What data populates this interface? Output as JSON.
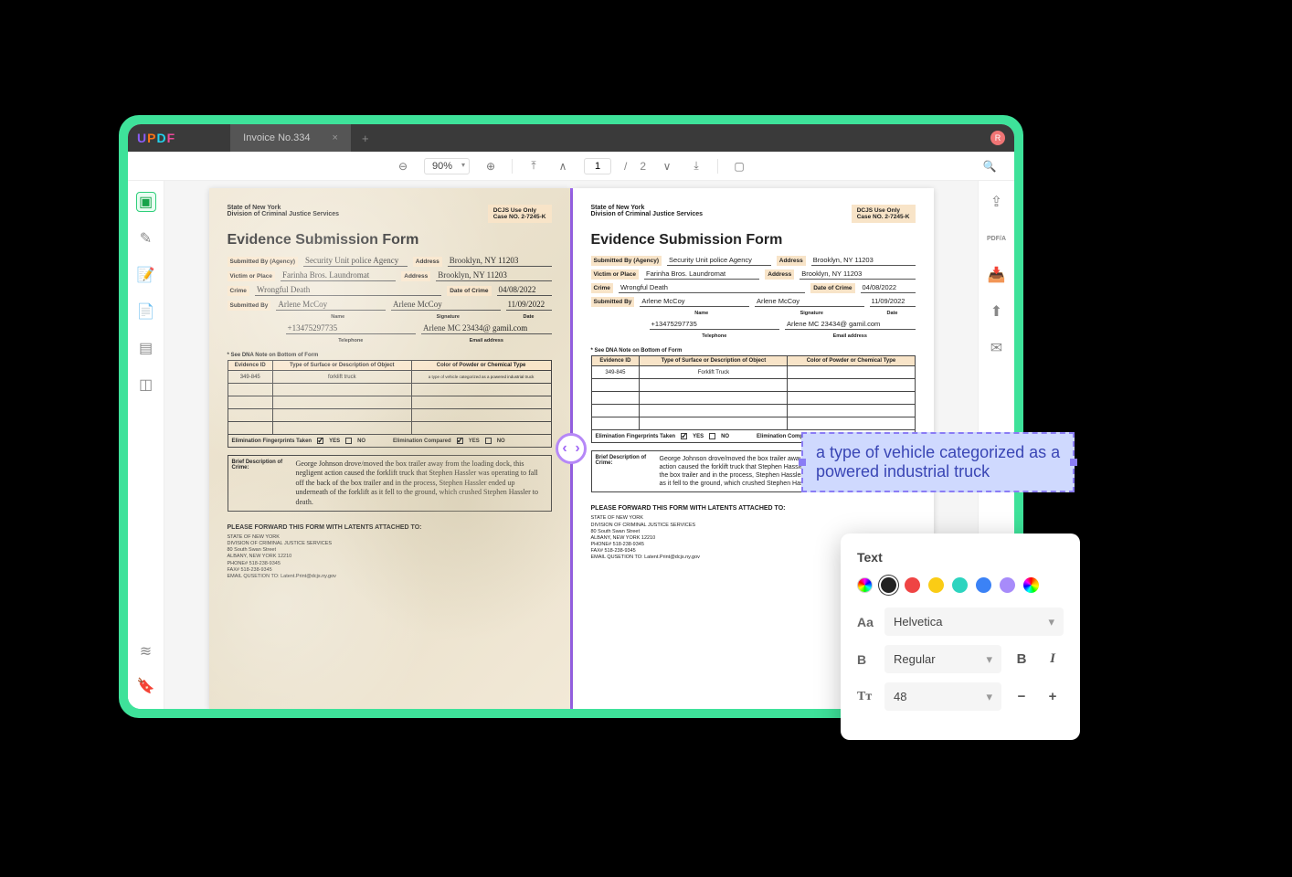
{
  "titlebar": {
    "tab": "Invoice No.334",
    "avatar": "R"
  },
  "toolbar": {
    "zoom": "90%",
    "pageCurrent": "1",
    "pageSep": "/",
    "pageTotal": "2"
  },
  "form": {
    "hdr1": "State of New York",
    "hdr2": "Division of Criminal Justice Services",
    "box1": "DCJS Use Only",
    "box2": "Case NO. 2-7245-K",
    "title": "Evidence Submission Form",
    "labels": {
      "subBy": "Submitted By (Agency)",
      "addr": "Address",
      "victim": "Victim or Place",
      "crime": "Crime",
      "dateCrime": "Date of Crime",
      "subBy2": "Submitted By",
      "name": "Name",
      "sig": "Signature",
      "date": "Date",
      "tel": "Telephone",
      "email": "Email address"
    },
    "scan": {
      "subBy": "Security Unit police Agency",
      "addr1": "Brooklyn, NY 11203",
      "victim": "Farinha Bros. Laundromat",
      "addr2": "Brooklyn, NY 11203",
      "crime": "Wrongful Death",
      "dateCrime": "04/08/2022",
      "name": "Arlene McCoy",
      "sig": "Arlene McCoy",
      "date": "11/09/2022",
      "tel": "+13475297735",
      "email": "Arlene MC 23434@ gamil.com"
    },
    "clean": {
      "subBy": "Security Unit police Agency",
      "addr1": "Brooklyn, NY 11203",
      "victim": "Farinha Bros. Laundromat",
      "addr2": "Brooklyn, NY 11203",
      "crime": "Wrongful Death",
      "dateCrime": "04/08/2022",
      "name": "Arlene McCoy",
      "sig": "Arlene McCoy",
      "date": "11/09/2022",
      "tel": "+13475297735",
      "email": "Arlene MC 23434@ gamil.com"
    },
    "note": "* See DNA Note on Bottom of Form",
    "th1": "Evidence ID",
    "th2": "Type of Surface or Description of Object",
    "th3": "Color of Powder or Chemical Type",
    "row1c1": "349-845",
    "row1c2_scan": "forklift truck",
    "row1c2_clean": "Forklift Truck",
    "row1c3_scan": "a type of vehicle categorized as a powered industrial truck",
    "elim": "Elimination Fingerprints Taken",
    "comp": "Elimination Compared",
    "yes": "YES",
    "no": "NO",
    "descL": "Brief Description of Crime:",
    "desc_scan": "George Johnson drove/moved the box trailer away from the loading dock, this negligent action caused the forklift truck that Stephen Hassler was operating to fall off the back of the box trailer and in the process, Stephen Hassler ended up underneath of the forklift as it fell to the ground, which crushed Stephen Hassler to death.",
    "desc_clean": "George Johnson drove/moved the box trailer away from the loading dock, this negligent action caused the forklift truck that Stephen Hassler was operating to fall off the back of the box trailer and in the process, Stephen Hassler ended up underneath of the forklift as it fell to the ground, which crushed Stephen Hassler to death.",
    "fwd": "PLEASE FORWARD THIS FORM WITH LATENTS ATTACHED TO:",
    "addr": "STATE OF NEW YORK\nDIVISION OF CRIMINAL JUSTICE SERVICES\n80 South Swan Street\nALBANY, NEW YORK 12210\nPHONE# 518-238-9345\nFAX# 518-238-9345\nEMAIL QUSETION TO: Latent.Print@dcjs.ny.gov"
  },
  "editbox": {
    "line1": "a type of vehicle categorized as a",
    "line2": "powered industrial truck"
  },
  "popup": {
    "title": "Text",
    "colors": [
      "#222222",
      "#ef4444",
      "#facc15",
      "#2dd4bf",
      "#3b82f6",
      "#a78bfa"
    ],
    "font": "Helvetica",
    "weight": "Regular",
    "size": "48"
  }
}
